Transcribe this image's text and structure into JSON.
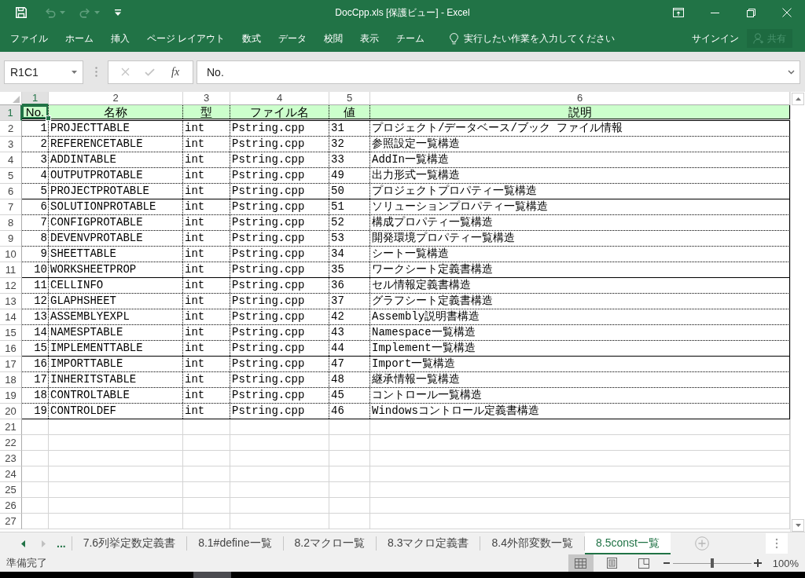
{
  "title_bar": {
    "quick_access": [
      {
        "kind": "save",
        "disabled": false
      },
      {
        "kind": "undo",
        "disabled": true
      },
      {
        "kind": "redo",
        "disabled": true
      },
      {
        "kind": "customize",
        "disabled": false
      }
    ],
    "title": "DocCpp.xls [保護ビュー] - Excel",
    "window_controls": [
      {
        "kind": "ribbon_display"
      },
      {
        "kind": "minimize"
      },
      {
        "kind": "restore"
      },
      {
        "kind": "close"
      }
    ]
  },
  "ribbon": {
    "tabs": [
      {
        "label": "ファイル",
        "selected": false
      },
      {
        "label": "ホーム",
        "selected": false
      },
      {
        "label": "挿入",
        "selected": false
      },
      {
        "label": "ページ レイアウト",
        "selected": false
      },
      {
        "label": "数式",
        "selected": false
      },
      {
        "label": "データ",
        "selected": false
      },
      {
        "label": "校閲",
        "selected": false
      },
      {
        "label": "表示",
        "selected": false
      },
      {
        "label": "チーム",
        "selected": false
      }
    ],
    "tell_me": {
      "placeholder": "実行したい作業を入力してください"
    },
    "sign_in": "サインイン",
    "share": {
      "label": "共有",
      "disabled": true
    }
  },
  "formula_bar": {
    "name_box": "R1C1",
    "buttons": [
      {
        "kind": "cancel",
        "disabled": true
      },
      {
        "kind": "enter",
        "disabled": true
      }
    ],
    "function_button": "fx",
    "formula": "No."
  },
  "sheet": {
    "column_headers": [
      {
        "label": "1",
        "selected": true
      },
      {
        "label": "2",
        "selected": false
      },
      {
        "label": "3",
        "selected": false
      },
      {
        "label": "4",
        "selected": false
      },
      {
        "label": "5",
        "selected": false
      },
      {
        "label": "6",
        "selected": false
      }
    ],
    "row_headers": [
      {
        "label": "1",
        "selected": true
      },
      {
        "label": "2",
        "selected": false
      },
      {
        "label": "3",
        "selected": false
      },
      {
        "label": "4",
        "selected": false
      },
      {
        "label": "5",
        "selected": false
      },
      {
        "label": "6",
        "selected": false
      },
      {
        "label": "7",
        "selected": false
      },
      {
        "label": "8",
        "selected": false
      },
      {
        "label": "9",
        "selected": false
      },
      {
        "label": "10",
        "selected": false
      },
      {
        "label": "11",
        "selected": false
      },
      {
        "label": "12",
        "selected": false
      },
      {
        "label": "13",
        "selected": false
      },
      {
        "label": "14",
        "selected": false
      },
      {
        "label": "15",
        "selected": false
      },
      {
        "label": "16",
        "selected": false
      },
      {
        "label": "17",
        "selected": false
      },
      {
        "label": "18",
        "selected": false
      },
      {
        "label": "19",
        "selected": false
      },
      {
        "label": "20",
        "selected": false
      },
      {
        "label": "21",
        "selected": false
      },
      {
        "label": "22",
        "selected": false
      },
      {
        "label": "23",
        "selected": false
      },
      {
        "label": "24",
        "selected": false
      },
      {
        "label": "25",
        "selected": false
      },
      {
        "label": "26",
        "selected": false
      },
      {
        "label": "27",
        "selected": false
      }
    ],
    "header_row": [
      {
        "text": "No.",
        "selected": true
      },
      {
        "text": "名称",
        "selected": false
      },
      {
        "text": "型",
        "selected": false
      },
      {
        "text": "ファイル名",
        "selected": false
      },
      {
        "text": "値",
        "selected": false
      },
      {
        "text": "説明",
        "selected": false
      }
    ],
    "rows": [
      {
        "cells": [
          "1",
          "PROJECTTABLE",
          "int",
          "Pstring.cpp",
          "31",
          "プロジェクト/データベース/ブック ファイル情報"
        ],
        "rule_below": false
      },
      {
        "cells": [
          "2",
          "REFERENCETABLE",
          "int",
          "Pstring.cpp",
          "32",
          "参照設定一覧構造"
        ],
        "rule_below": false
      },
      {
        "cells": [
          "3",
          "ADDINTABLE",
          "int",
          "Pstring.cpp",
          "33",
          "AddIn一覧構造"
        ],
        "rule_below": false
      },
      {
        "cells": [
          "4",
          "OUTPUTPROTABLE",
          "int",
          "Pstring.cpp",
          "49",
          "出力形式一覧構造"
        ],
        "rule_below": false
      },
      {
        "cells": [
          "5",
          "PROJECTPROTABLE",
          "int",
          "Pstring.cpp",
          "50",
          "プロジェクトプロパティ一覧構造"
        ],
        "rule_below": true
      },
      {
        "cells": [
          "6",
          "SOLUTIONPROTABLE",
          "int",
          "Pstring.cpp",
          "51",
          "ソリューションプロパティ一覧構造"
        ],
        "rule_below": false
      },
      {
        "cells": [
          "7",
          "CONFIGPROTABLE",
          "int",
          "Pstring.cpp",
          "52",
          "構成プロパティ一覧構造"
        ],
        "rule_below": false
      },
      {
        "cells": [
          "8",
          "DEVENVPROTABLE",
          "int",
          "Pstring.cpp",
          "53",
          "開発環境プロパティ一覧構造"
        ],
        "rule_below": false
      },
      {
        "cells": [
          "9",
          "SHEETTABLE",
          "int",
          "Pstring.cpp",
          "34",
          "シート一覧構造"
        ],
        "rule_below": false
      },
      {
        "cells": [
          "10",
          "WORKSHEETPROP",
          "int",
          "Pstring.cpp",
          "35",
          "ワークシート定義書構造"
        ],
        "rule_below": true
      },
      {
        "cells": [
          "11",
          "CELLINFO",
          "int",
          "Pstring.cpp",
          "36",
          "セル情報定義書構造"
        ],
        "rule_below": false
      },
      {
        "cells": [
          "12",
          "GLAPHSHEET",
          "int",
          "Pstring.cpp",
          "37",
          "グラフシート定義書構造"
        ],
        "rule_below": false
      },
      {
        "cells": [
          "13",
          "ASSEMBLYEXPL",
          "int",
          "Pstring.cpp",
          "42",
          "Assembly説明書構造"
        ],
        "rule_below": false
      },
      {
        "cells": [
          "14",
          "NAMESPTABLE",
          "int",
          "Pstring.cpp",
          "43",
          "Namespace一覧構造"
        ],
        "rule_below": false
      },
      {
        "cells": [
          "15",
          "IMPLEMENTTABLE",
          "int",
          "Pstring.cpp",
          "44",
          "Implement一覧構造"
        ],
        "rule_below": true
      },
      {
        "cells": [
          "16",
          "IMPORTTABLE",
          "int",
          "Pstring.cpp",
          "47",
          "Import一覧構造"
        ],
        "rule_below": false
      },
      {
        "cells": [
          "17",
          "INHERITSTABLE",
          "int",
          "Pstring.cpp",
          "48",
          "継承情報一覧構造"
        ],
        "rule_below": false
      },
      {
        "cells": [
          "18",
          "CONTROLTABLE",
          "int",
          "Pstring.cpp",
          "45",
          "コントロール一覧構造"
        ],
        "rule_below": false
      },
      {
        "cells": [
          "19",
          "CONTROLDEF",
          "int",
          "Pstring.cpp",
          "46",
          "Windowsコントロール定義書構造"
        ],
        "rule_below": true
      }
    ]
  },
  "sheet_tabs": {
    "navigation": [
      {
        "kind": "previous",
        "disabled": false
      },
      {
        "kind": "next",
        "disabled": true
      }
    ],
    "overflow": "...",
    "tabs": [
      {
        "label": "7.6列挙定数定義書",
        "selected": false
      },
      {
        "label": "8.1#define一覧",
        "selected": false
      },
      {
        "label": "8.2マクロ一覧",
        "selected": false
      },
      {
        "label": "8.3マクロ定義書",
        "selected": false
      },
      {
        "label": "8.4外部変数一覧",
        "selected": false
      },
      {
        "label": "8.5const一覧",
        "selected": true
      }
    ]
  },
  "status_bar": {
    "status": "準備完了",
    "views": [
      {
        "kind": "normal",
        "selected": true
      },
      {
        "kind": "page_layout",
        "selected": false
      },
      {
        "kind": "page_break_preview",
        "selected": false
      }
    ],
    "zoom": {
      "level": 0.5,
      "reading": "100%"
    }
  }
}
